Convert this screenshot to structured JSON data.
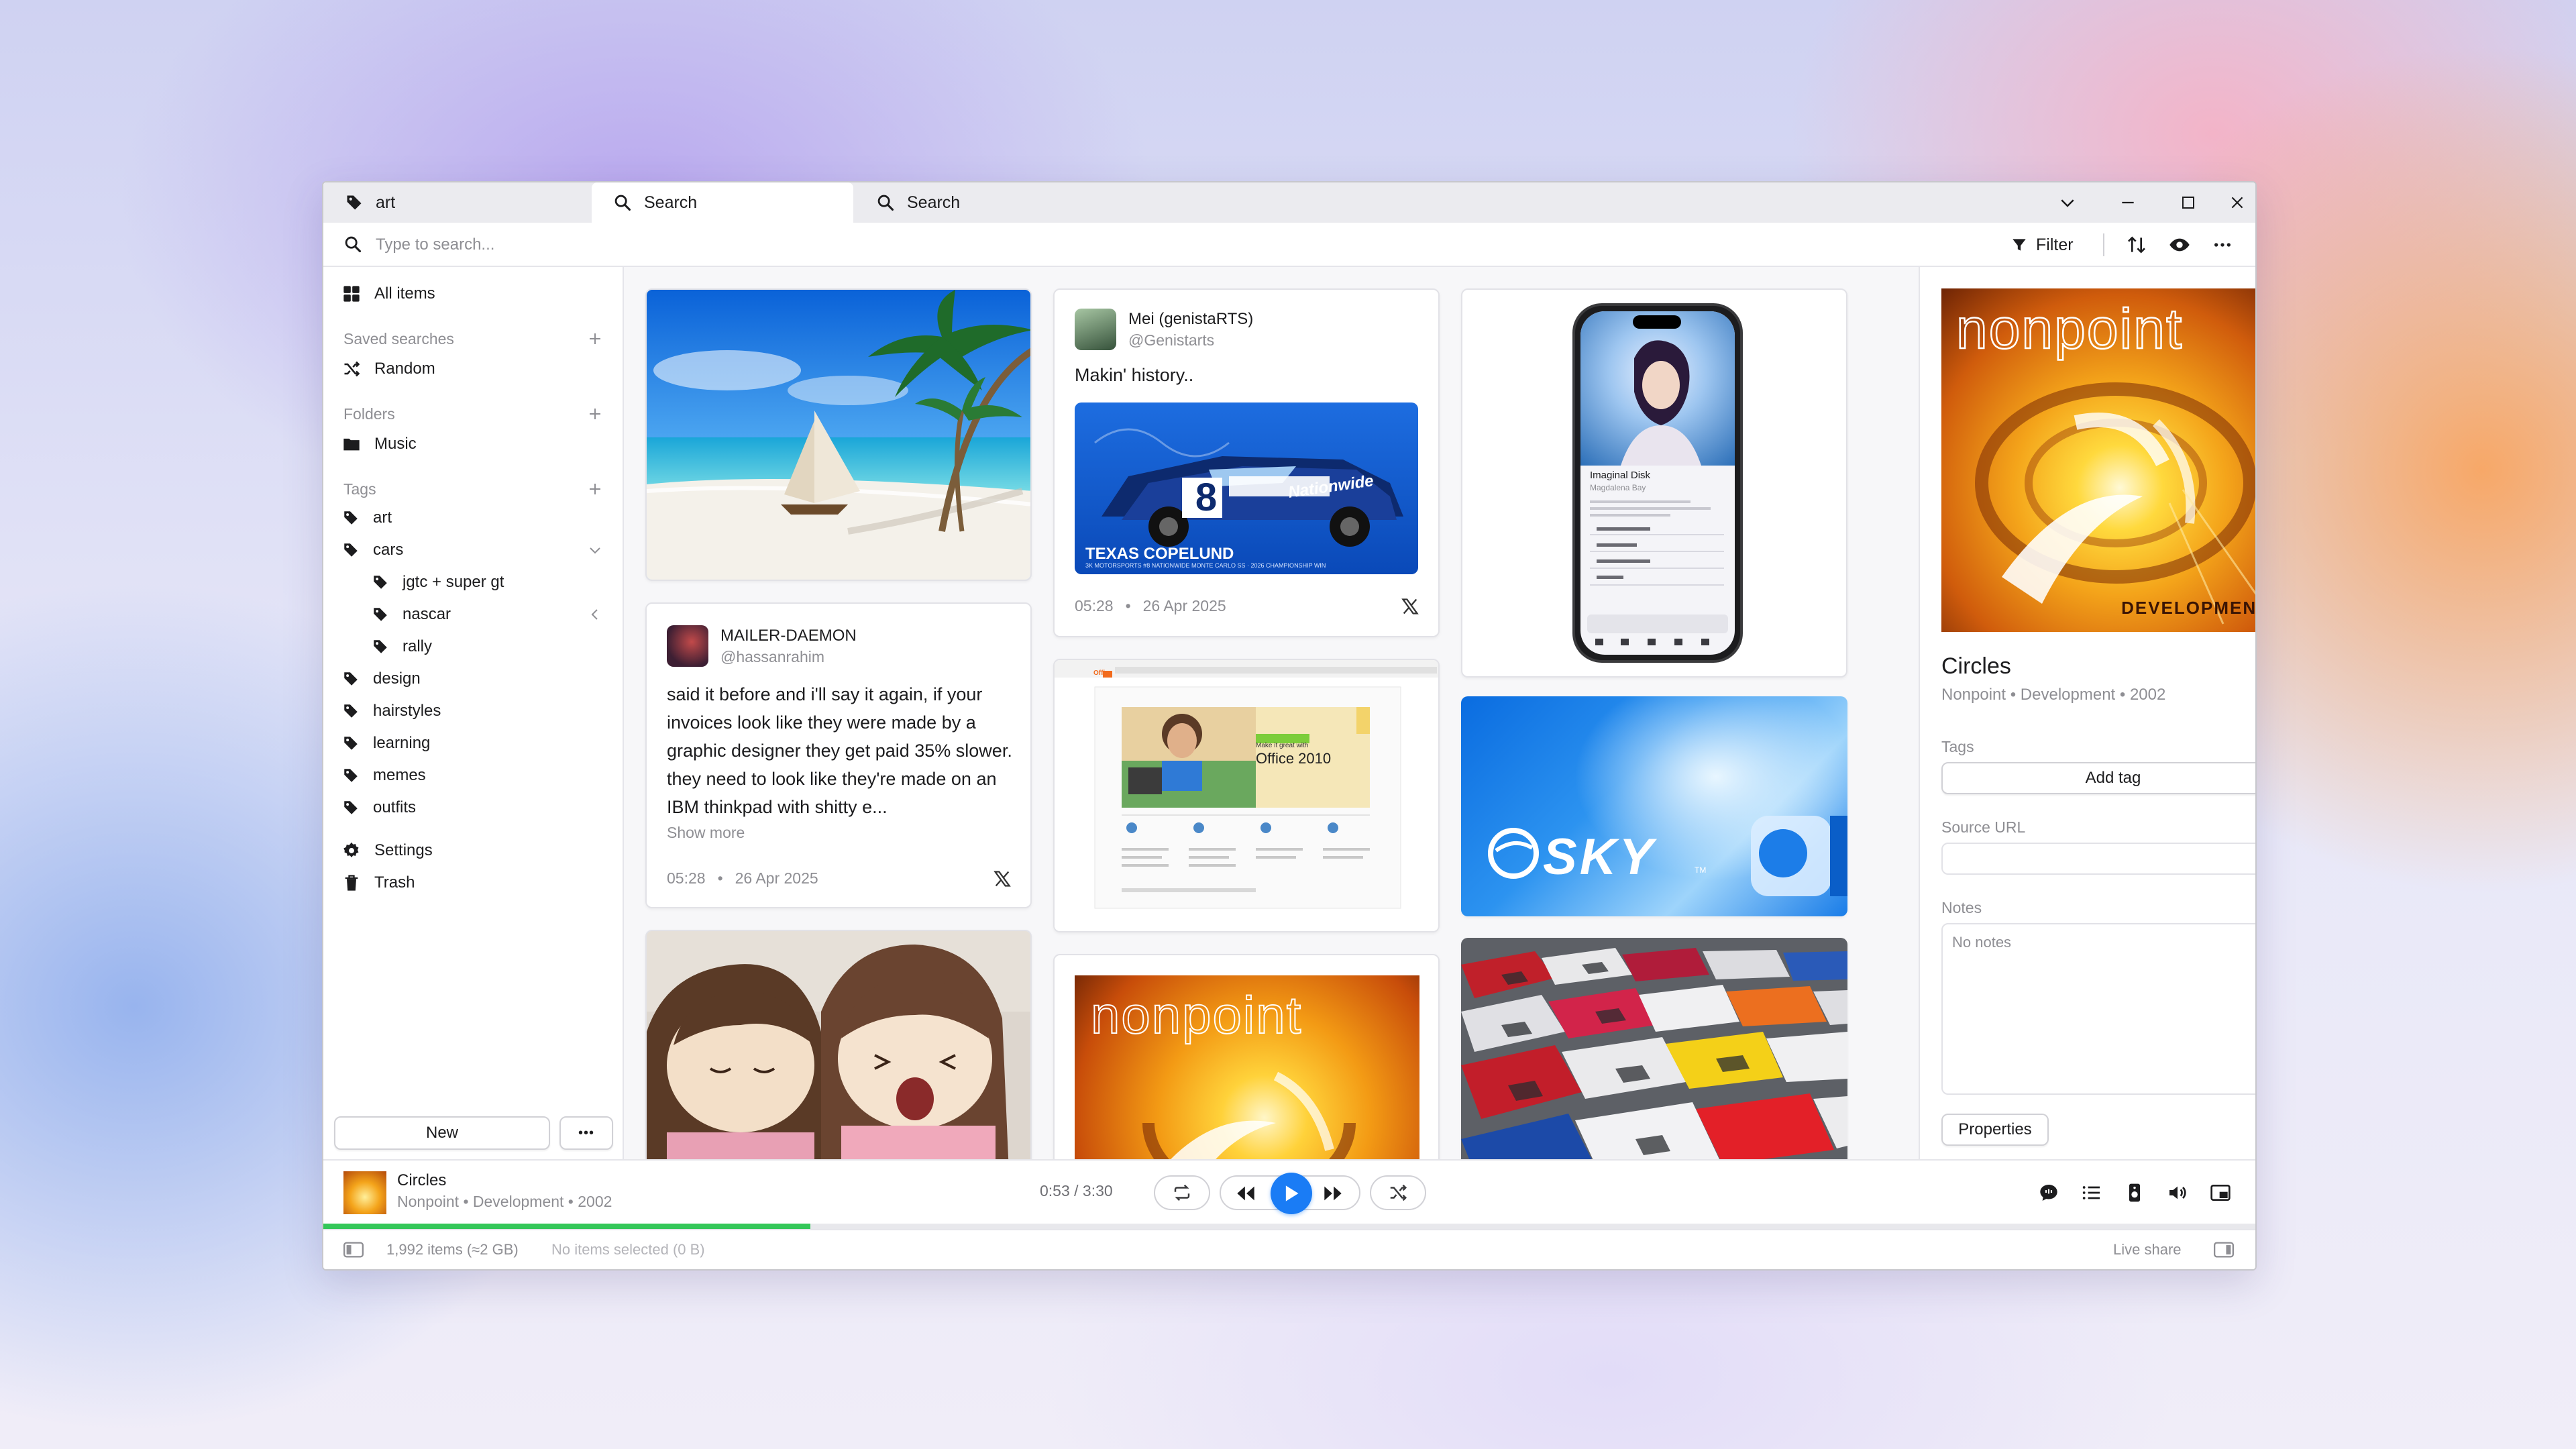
{
  "tabs": [
    {
      "label": "art",
      "icon": "tag-icon"
    },
    {
      "label": "Search",
      "icon": "search-icon"
    },
    {
      "label": "Search",
      "icon": "search-icon"
    }
  ],
  "toolbar": {
    "search_placeholder": "Type to search...",
    "filter_label": "Filter"
  },
  "sidebar": {
    "all_items": "All items",
    "saved_searches_header": "Saved searches",
    "saved_searches": [
      "Random"
    ],
    "folders_header": "Folders",
    "folders": [
      "Music"
    ],
    "tags_header": "Tags",
    "tags": [
      {
        "label": "art",
        "level": 0
      },
      {
        "label": "cars",
        "level": 0,
        "expanded": true
      },
      {
        "label": "jgtc + super gt",
        "level": 1
      },
      {
        "label": "nascar",
        "level": 1
      },
      {
        "label": "rally",
        "level": 1
      },
      {
        "label": "design",
        "level": 0
      },
      {
        "label": "hairstyles",
        "level": 0
      },
      {
        "label": "learning",
        "level": 0
      },
      {
        "label": "memes",
        "level": 0
      },
      {
        "label": "outfits",
        "level": 0
      }
    ],
    "settings": "Settings",
    "trash": "Trash",
    "new_button": "New",
    "more_button": "•••"
  },
  "cards": {
    "tweet1": {
      "name": "MAILER-DAEMON",
      "handle": "@hassanrahim",
      "text": "said it before and i'll say it again, if your invoices look like they were made by a graphic designer they get paid 35% slower. they need to look like they're made on an IBM thinkpad with shitty e...",
      "show_more": "Show more",
      "time": "05:28",
      "date": "26 Apr 2025"
    },
    "tweet2": {
      "name": "Mei (genistaRTS)",
      "handle": "@Genistarts",
      "text": "Makin' history..",
      "time": "05:28",
      "date": "26 Apr 2025",
      "image_caption": "TEXAS COPELUND",
      "image_subcaption": "3K MOTORSPORTS #8 NATIONWIDE MONTE CARLO SS · 2026 CHAMPIONSHIP WIN",
      "image_brand": "Nationwide",
      "image_number": "8"
    },
    "office_ad": {
      "line1": "Make it great with",
      "line2": "Office 2010",
      "brand": "Office"
    },
    "sky": {
      "logo": "SKY",
      "tm": "TM"
    },
    "nonpoint": {
      "logo": "nonpoint"
    },
    "phone": {
      "song": "Imaginal Disk",
      "artist": "Magdalena Bay"
    }
  },
  "details": {
    "art_logo": "nonpoint",
    "art_caption": "DEVELOPMENT",
    "title": "Circles",
    "subtitle": "Nonpoint • Development • 2002",
    "tags_label": "Tags",
    "add_tag": "Add tag",
    "source_url_label": "Source URL",
    "source_url_value": "",
    "notes_label": "Notes",
    "notes_placeholder": "No notes",
    "properties_button": "Properties"
  },
  "player": {
    "title": "Circles",
    "subtitle": "Nonpoint • Development • 2002",
    "time": "0:53 / 3:30",
    "progress": 0.252
  },
  "status": {
    "items": "1,992 items (≈2 GB)",
    "selected": "No items selected (0 B)",
    "live_share": "Live share"
  },
  "colors": {
    "accent": "#1a7cf5",
    "progress": "#34c759",
    "border": "#e5e5ea",
    "muted_text": "#8e8e93"
  }
}
